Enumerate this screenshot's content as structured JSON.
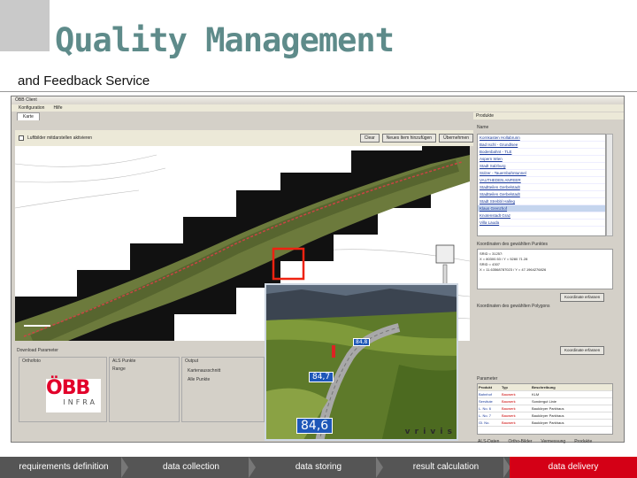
{
  "slide": {
    "title": "Quality Management",
    "subtitle": "and Feedback Service"
  },
  "colors": {
    "title": "#5e8b8a",
    "active_step": "#d40016",
    "process_bar": "#555555",
    "obb_red": "#e2002a"
  },
  "app": {
    "titlebar": "ÖBB Client",
    "menu": [
      "Konfiguration",
      "Hilfe"
    ],
    "tab": "Karte",
    "toolbar": {
      "checkbox_label": "Luftbilder mitdarstellen aktivieren",
      "buttons": [
        "Clear",
        "Neues Item hinzufügen",
        "Übernehmen"
      ]
    },
    "right_panel": {
      "header": "Produkte",
      "list_header": "Name",
      "list_items": [
        "Kornkasten Hollabrunn",
        "Bad Ischl - Grundlsee",
        "Bodenbahnt - TLE",
        "Aspern Wien",
        "Stadt Salzburg",
        "Sülzer - Tauernbahntunnel",
        "VAUTHEDEN ANFEER",
        "Stadtteilen Gerbelstadt",
        "Stadtteilen Gerbelstadt",
        "Stadt Strebbl Halleg",
        "Klaus Grenzhof",
        "Knotenstadt Graz",
        "Villa Lauda"
      ],
      "coord_label": "Koordinaten des gewählten Punktes",
      "coord_text": [
        "SRID = 31257:",
        "X = 80300.53 / Y = 5280 71.28",
        "SRID = 4307",
        "X = 11.63568787023 / Y = 47.1964276826"
      ],
      "coord_button": "Koordinate erfassen",
      "poly_label": "Koordinaten des gewählten Polygons",
      "poly_button": "Koordinate erfassen",
      "table_label": "Parameter",
      "table_header": [
        "Produkt",
        "Typ",
        "Beschreibung"
      ],
      "table_rows": [
        [
          "Bahnhof",
          "Bauwerk",
          "KLM"
        ],
        [
          "Servitute",
          "Bauwerk",
          "Sondergut Linie"
        ],
        [
          "L. No. 6",
          "Bauwerk",
          "Baukörper Parkhaus"
        ],
        [
          "L. No. 7",
          "Bauwerk",
          "Baukörper Parkhaus"
        ],
        [
          "Gl. No.",
          "Bauwerk",
          "Baukörper Parkhaus"
        ]
      ]
    },
    "bottom": {
      "download_label": "Download Parameter",
      "group_ortho": "Orthofoto",
      "group_als": "ALS Punkte",
      "group_output": "Output",
      "als_range": "Range",
      "radio1": "Kartenausschnitt",
      "radio2": "Alle Punkte"
    },
    "legend": [
      "ALS-Daten",
      "Ortho-Bilder",
      "Vermessung",
      "Produkte"
    ]
  },
  "view3d": {
    "tags": [
      "84,8",
      "84,7",
      "84,6"
    ],
    "brand": "v r i v i s"
  },
  "logo": {
    "word": "ÖBB",
    "sub": "INFRA"
  },
  "process": {
    "steps": [
      "requirements definition",
      "data collection",
      "data storing",
      "result calculation",
      "data delivery"
    ],
    "active_index": 4
  }
}
